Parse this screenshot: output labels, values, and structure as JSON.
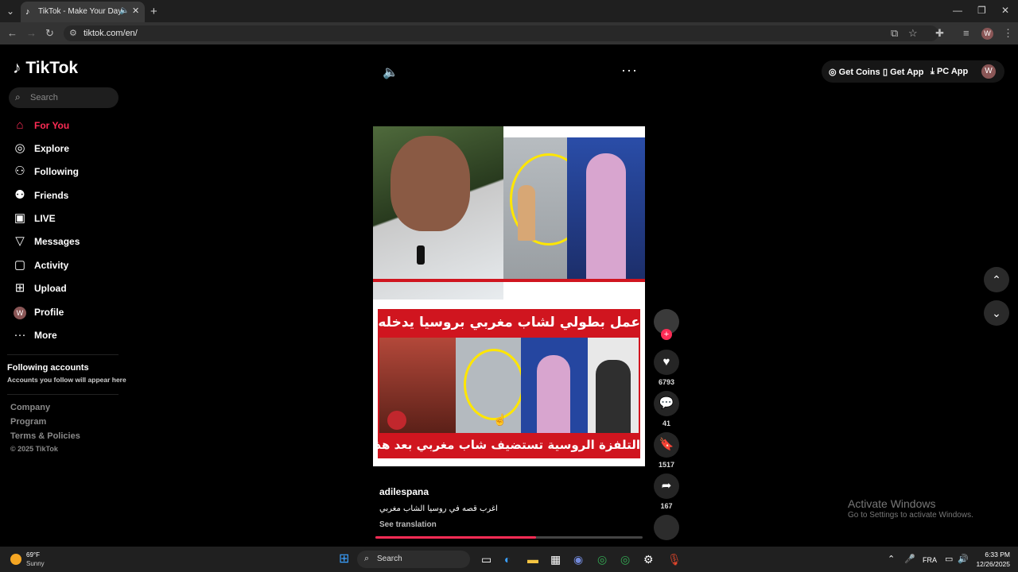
{
  "browser": {
    "tab_title": "TikTok - Make Your Day",
    "url": "tiktok.com/en/",
    "profile_initial": "W"
  },
  "sidebar": {
    "logo": "TikTok",
    "search_placeholder": "Search",
    "items": [
      {
        "label": "For You",
        "icon": "home-icon"
      },
      {
        "label": "Explore",
        "icon": "compass-icon"
      },
      {
        "label": "Following",
        "icon": "person-icon"
      },
      {
        "label": "Friends",
        "icon": "friends-icon"
      },
      {
        "label": "LIVE",
        "icon": "live-icon"
      },
      {
        "label": "Messages",
        "icon": "paper-plane-icon"
      },
      {
        "label": "Activity",
        "icon": "activity-icon"
      },
      {
        "label": "Upload",
        "icon": "plus-box-icon"
      },
      {
        "label": "Profile",
        "icon": "avatar-icon"
      },
      {
        "label": "More",
        "icon": "ellipsis-icon"
      }
    ],
    "following_title": "Following accounts",
    "following_sub": "Accounts you follow will appear here",
    "footer": [
      "Company",
      "Program",
      "Terms & Policies"
    ],
    "copyright": "© 2025 TikTok"
  },
  "topbar": {
    "get_coins": "Get Coins",
    "get_app": "Get App",
    "pc_app": "PC App",
    "avatar_initial": "W"
  },
  "video": {
    "headline_top": "عمل بطولي لشاب مغربي بروسيا يدخله التاريخ",
    "headline_bottom": "التلفزة الروسية تستضيف شاب مغربي بعد هذا الموقف",
    "author": "adilespana",
    "caption": "اغرب قصه في روسيا الشاب مغربي",
    "see_translation": "See translation",
    "progress_fraction": 0.6
  },
  "actions": {
    "likes": "6793",
    "comments": "41",
    "saves": "1517",
    "shares": "167"
  },
  "watermark": {
    "title": "Activate Windows",
    "sub": "Go to Settings to activate Windows."
  },
  "taskbar": {
    "temp": "69°F",
    "weather": "Sunny",
    "search": "Search",
    "lang": "FRA",
    "time": "6:33 PM",
    "date": "12/26/2025"
  }
}
